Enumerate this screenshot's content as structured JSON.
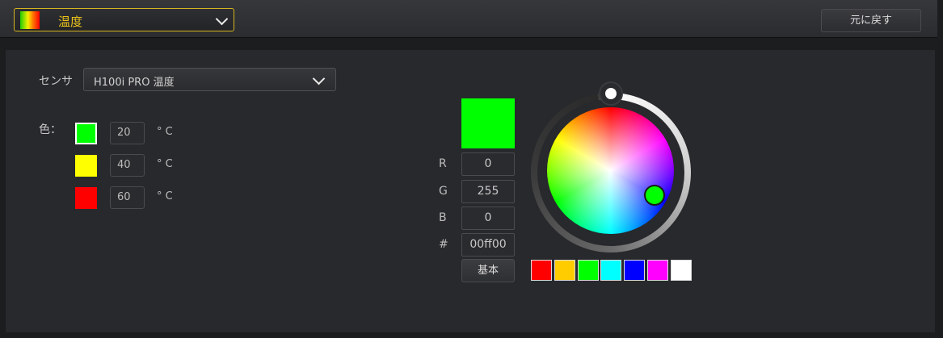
{
  "header": {
    "mode_select": {
      "label": "温度",
      "icon": "gradient-icon",
      "accent": "#e8c21b"
    },
    "reset_label": "元に戻す"
  },
  "sensor": {
    "label": "センサ",
    "value": "H100i PRO 温度"
  },
  "colors": {
    "label": "色：",
    "rows": [
      {
        "color": "#00ff00",
        "value": "20",
        "unit": "° C",
        "selected": true
      },
      {
        "color": "#ffff00",
        "value": "40",
        "unit": "° C",
        "selected": false
      },
      {
        "color": "#ff0000",
        "value": "60",
        "unit": "° C",
        "selected": false
      }
    ]
  },
  "picker": {
    "preview_color": "#00ff00",
    "r_label": "R",
    "r_value": "0",
    "g_label": "G",
    "g_value": "255",
    "b_label": "B",
    "b_value": "0",
    "hex_label": "#",
    "hex_value": "00ff00",
    "basic_label": "基本",
    "quick_colors": [
      "#ff0000",
      "#ffcc00",
      "#00ff00",
      "#00ffff",
      "#0000ff",
      "#ff00ff",
      "#ffffff"
    ]
  }
}
